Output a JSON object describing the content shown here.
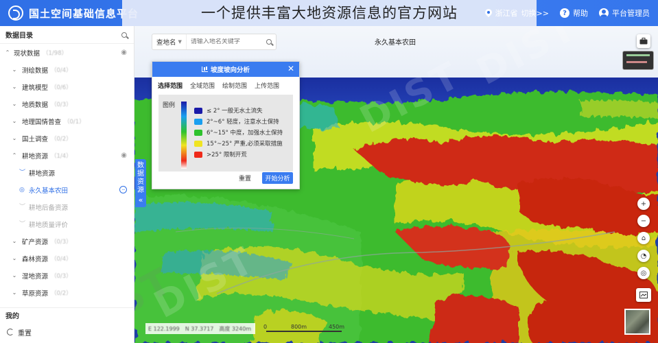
{
  "header": {
    "app_title": "国土空间基础信息平台",
    "overlay_title": "一个提供丰富大地资源信息的官方网站",
    "region": "浙江省",
    "switch_label": "切换>>",
    "help_label": "帮助",
    "admin_label": "平台管理员",
    "help_icon": "question-icon",
    "user_icon": "user-icon",
    "location_icon": "location-pin-icon"
  },
  "sidebar": {
    "title": "数据目录",
    "items": [
      {
        "label": "现状数据",
        "count": "（1/98）",
        "level": 0,
        "expanded": true,
        "eye": true
      },
      {
        "label": "测绘数据",
        "count": "（0/4）",
        "level": 1
      },
      {
        "label": "建筑模型",
        "count": "（0/6）",
        "level": 1
      },
      {
        "label": "地质数据",
        "count": "（0/3）",
        "level": 1
      },
      {
        "label": "地理国情普查",
        "count": "（0/1）",
        "level": 1
      },
      {
        "label": "国土调查",
        "count": "（0/2）",
        "level": 1
      },
      {
        "label": "耕地资源",
        "count": "（1/4）",
        "level": 1,
        "expanded": true,
        "eye": true
      },
      {
        "label": "耕地资源",
        "level": 2
      },
      {
        "label": "永久基本农田",
        "level": 2,
        "active": true
      },
      {
        "label": "耕地后备资源",
        "level": 2,
        "disabled": true
      },
      {
        "label": "耕地质量评价",
        "level": 2,
        "disabled": true
      },
      {
        "label": "矿产资源",
        "count": "（0/3）",
        "level": 1
      },
      {
        "label": "森林资源",
        "count": "（0/4）",
        "level": 1
      },
      {
        "label": "湿地资源",
        "count": "（0/3）",
        "level": 1
      },
      {
        "label": "草原资源",
        "count": "（0/2）",
        "level": 1
      }
    ],
    "my_title": "我的",
    "reset_label": "重置"
  },
  "side_tab": {
    "label": "数据资源",
    "chevron": "«"
  },
  "map": {
    "label": "永久基本农田",
    "search": {
      "select_label": "查地名",
      "placeholder": "请输入地名关键字"
    },
    "watermark": "DIST"
  },
  "panel": {
    "title": "坡度坡向分析",
    "tabs_lead": "选择范围",
    "tabs": [
      "全域范围",
      "绘制范围",
      "上传范围"
    ],
    "legend_title": "图例",
    "legend": [
      {
        "label": "≤ 2° 一般无水土流失",
        "color": "#1a1aa8"
      },
      {
        "label": "2°~6° 轻度，注意水土保持",
        "color": "#1a9ff0"
      },
      {
        "label": "6°~15° 中度，加强水土保持",
        "color": "#2ec22e"
      },
      {
        "label": "15°~25° 严重,必须采取措施",
        "color": "#f0e422"
      },
      {
        "label": ">25° 限制开荒",
        "color": "#ef2a1a"
      }
    ],
    "reset_label": "重置",
    "start_label": "开始分析"
  },
  "status": {
    "lon": "E 122.1999",
    "lat": "N 37.3717",
    "height": "高度 3240m"
  },
  "scale": {
    "t0": "0",
    "t1": "800m",
    "t2": "450m"
  },
  "controls": [
    "briefcase-icon",
    "zoom-in-icon",
    "zoom-out-icon",
    "home-icon",
    "compass-icon",
    "3d-icon",
    "layers-icon"
  ]
}
